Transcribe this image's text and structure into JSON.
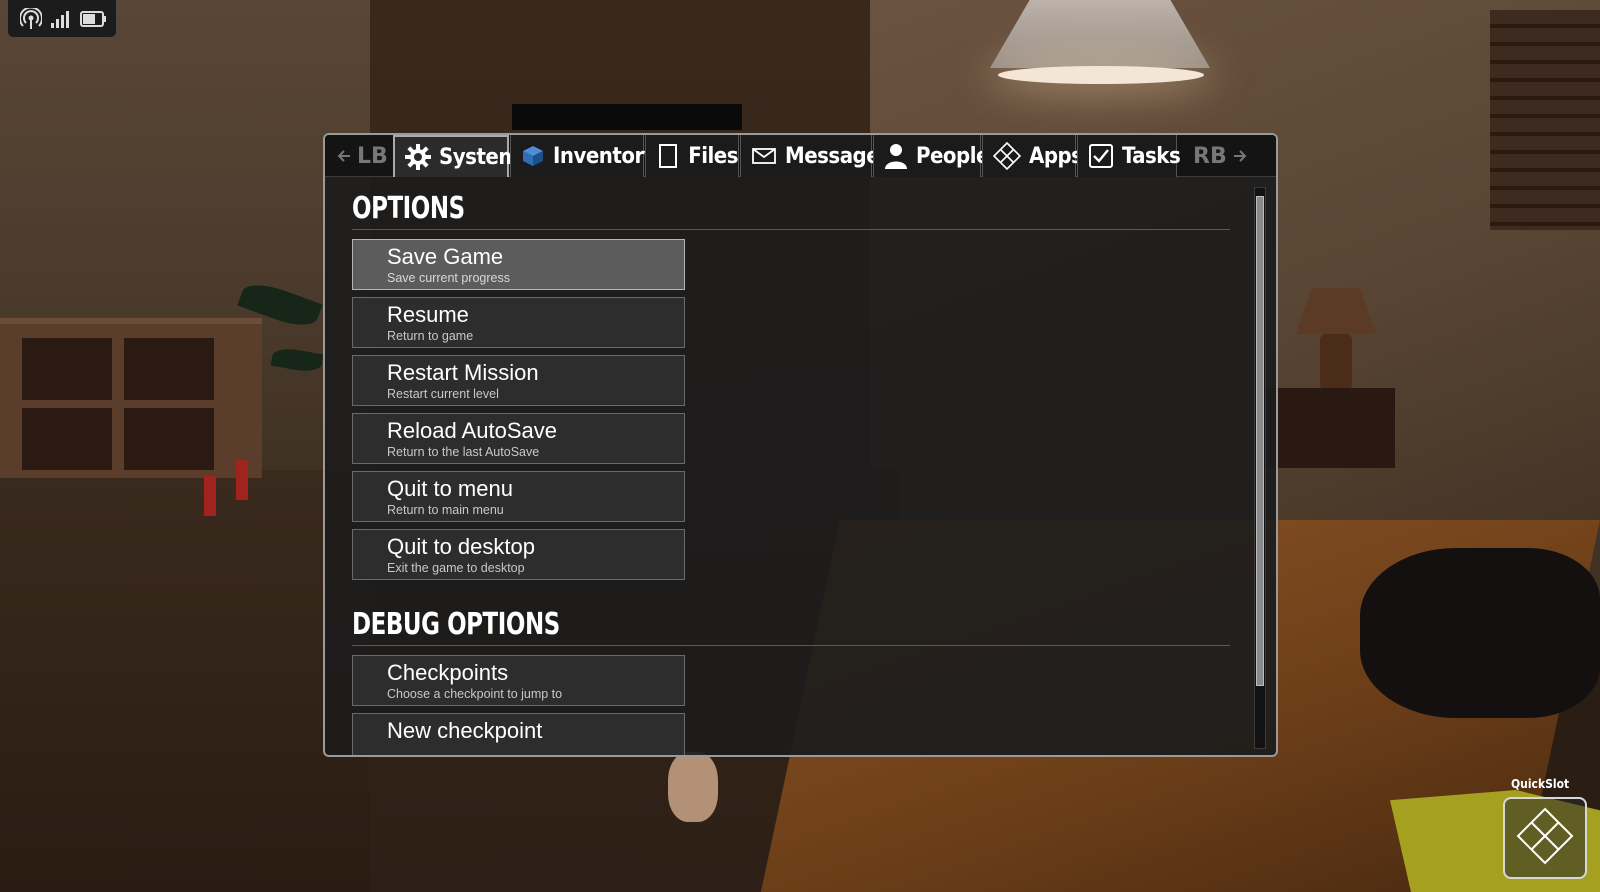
{
  "status_bar": {
    "icons": [
      "signal-broadcast-icon",
      "cellular-signal-icon",
      "battery-icon"
    ]
  },
  "tabs": {
    "left_bumper": "LB",
    "right_bumper": "RB",
    "items": [
      {
        "label": "System",
        "icon": "gear-icon",
        "active": true
      },
      {
        "label": "Inventory",
        "icon": "cube-icon",
        "active": false
      },
      {
        "label": "Files",
        "icon": "file-icon",
        "active": false
      },
      {
        "label": "Messages",
        "icon": "envelope-icon",
        "active": false
      },
      {
        "label": "People",
        "icon": "person-icon",
        "active": false
      },
      {
        "label": "Apps",
        "icon": "diamond-apps-icon",
        "active": false
      },
      {
        "label": "Tasks",
        "icon": "checkbox-icon",
        "active": false
      }
    ]
  },
  "options": {
    "heading": "OPTIONS",
    "items": [
      {
        "label": "Save Game",
        "sub": "Save current progress",
        "active": true
      },
      {
        "label": "Resume",
        "sub": "Return to game",
        "active": false
      },
      {
        "label": "Restart Mission",
        "sub": "Restart current level",
        "active": false
      },
      {
        "label": "Reload AutoSave",
        "sub": "Return to the last AutoSave",
        "active": false
      },
      {
        "label": "Quit to menu",
        "sub": "Return to main menu",
        "active": false
      },
      {
        "label": "Quit to desktop",
        "sub": "Exit the game to desktop",
        "active": false
      }
    ]
  },
  "debug_options": {
    "heading": "DEBUG OPTIONS",
    "items": [
      {
        "label": "Checkpoints",
        "sub": "Choose a checkpoint to jump to"
      },
      {
        "label": "New checkpoint",
        "sub": ""
      }
    ]
  },
  "quickslot": {
    "label": "QuickSlot",
    "icon": "diamond-slot-icon"
  },
  "colors": {
    "panel_bg": "#1c1c1c",
    "panel_border": "#9a9a9a",
    "active_option_bg": "#5c5c5c",
    "option_bg": "#2d2d2d",
    "text": "#ffffff"
  }
}
